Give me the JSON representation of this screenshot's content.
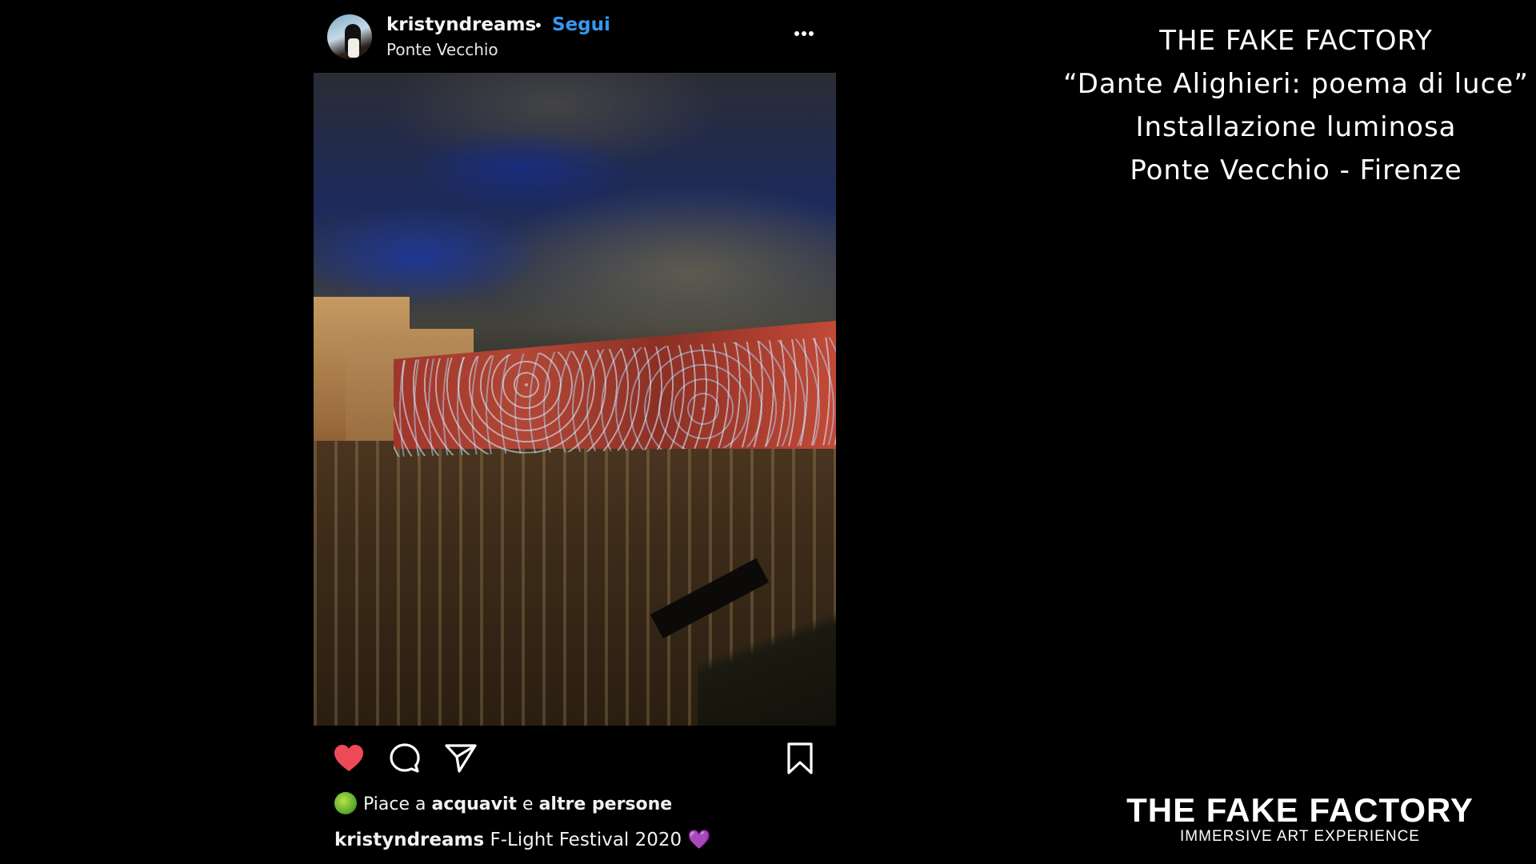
{
  "post": {
    "username": "kristyndreams",
    "separator": "•",
    "follow_label": "Segui",
    "location": "Ponte Vecchio",
    "more_icon": "ellipsis-icon",
    "actions": {
      "like_icon": "heart-filled-icon",
      "like_color": "#ed4956",
      "comment_icon": "comment-icon",
      "share_icon": "send-icon",
      "save_icon": "bookmark-icon"
    },
    "likes": {
      "prefix": "Piace a ",
      "user": "acquavit",
      "middle": " e ",
      "others": "altre persone"
    },
    "caption": {
      "user": "kristyndreams",
      "text": " F-Light Festival 2020 ",
      "emoji": "💜"
    },
    "follow_color": "#3897f0"
  },
  "info": {
    "line1": "THE FAKE FACTORY",
    "line2": "“Dante Alighieri: poema di luce”",
    "line3": "Installazione luminosa",
    "line4": "Ponte Vecchio - Firenze"
  },
  "logo": {
    "brand": "THE FAKE FACTORY",
    "tagline": "IMMERSIVE ART EXPERIENCE"
  }
}
